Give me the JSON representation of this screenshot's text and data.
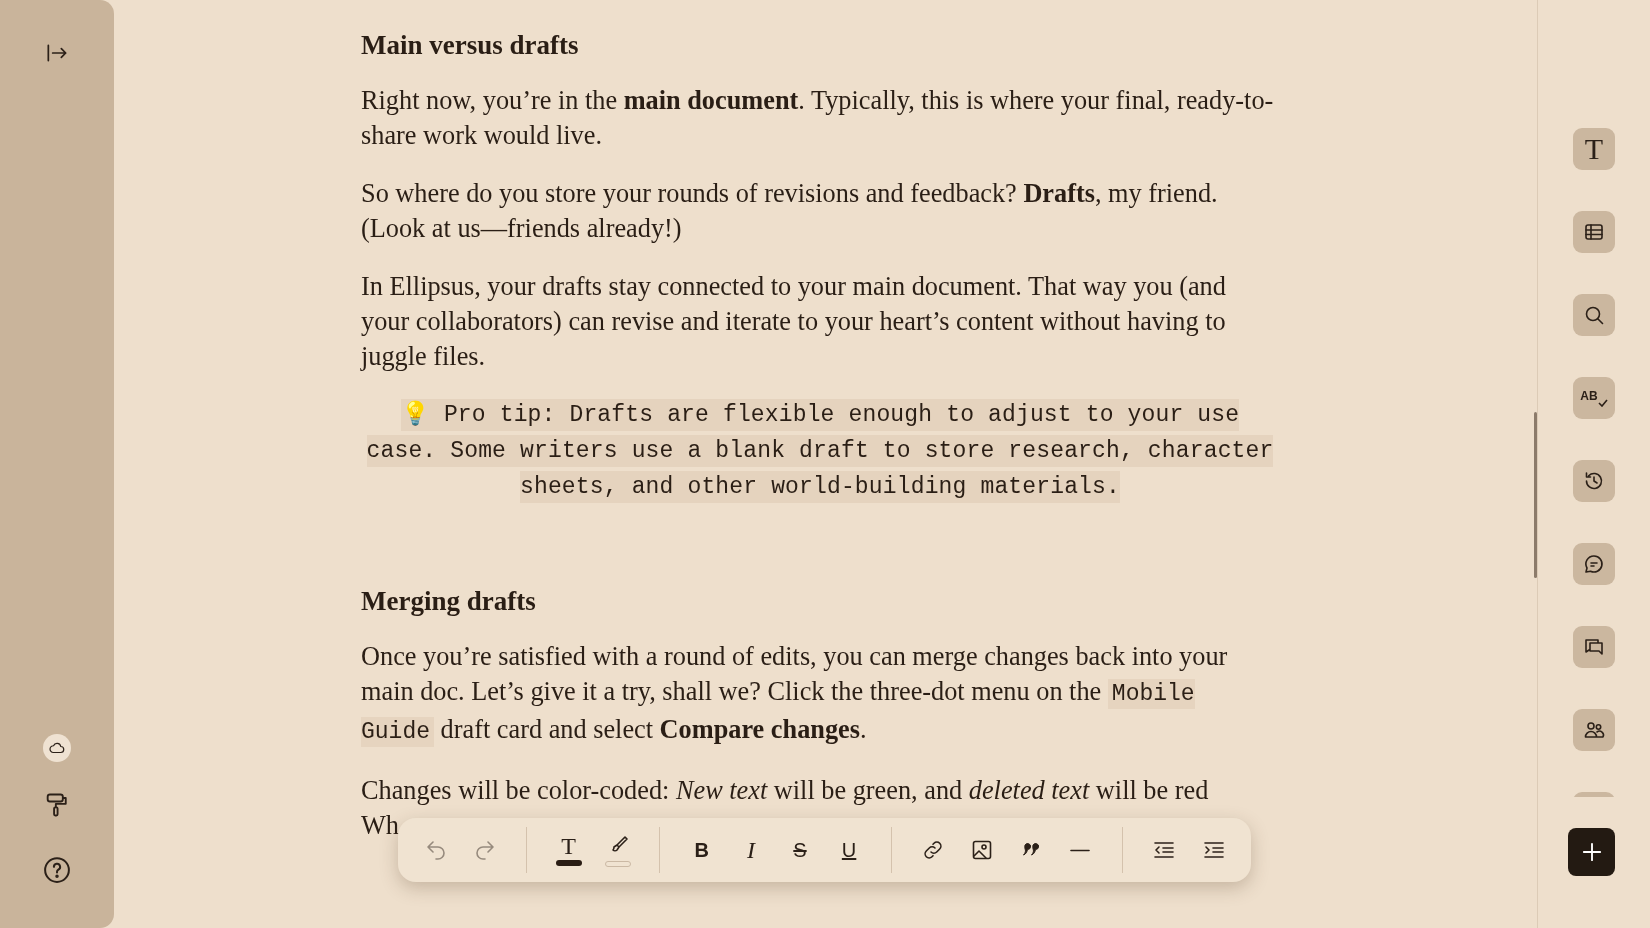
{
  "document": {
    "sections": [
      {
        "heading": "Main versus drafts",
        "blocks": [
          {
            "kind": "paragraph",
            "segments": [
              {
                "kind": "rich",
                "text": "Right now, you’re in the **main document**. Typically, this is where your final, ready-to-share work would live."
              }
            ]
          },
          {
            "kind": "paragraph",
            "segments": [
              {
                "kind": "rich",
                "text": "So where do you store your rounds of revisions and feedback? **Drafts**, my friend. (Look at us—friends already!)"
              }
            ]
          },
          {
            "kind": "paragraph",
            "segments": [
              {
                "kind": "rich",
                "text": "In Ellipsus, your drafts stay connected to your main document. That way you (and your collaborators) can revise and iterate to your heart’s content without having to juggle files."
              }
            ]
          },
          {
            "kind": "callout",
            "emoji": "💡",
            "text": "Pro tip: Drafts are flexible enough to adjust to your use case. Some writers use a blank draft to store research, character sheets, and other world-building materials."
          }
        ]
      },
      {
        "heading": "Merging drafts",
        "blocks": [
          {
            "kind": "paragraph",
            "segments": [
              {
                "kind": "rich",
                "text": "Once you’re satisfied with a round of edits, you can merge changes back into your main doc. Let’s give it a try, shall we? Click the three-dot menu on the "
              },
              {
                "kind": "code",
                "text": "Mobile Guide"
              },
              {
                "kind": "rich",
                "text": " draft card and select **Compare changes**."
              }
            ]
          },
          {
            "kind": "cut_paragraph",
            "lines": [
              "Changes will be color-coded: *New text* will be green, and *deleted text* will be red",
              "Wh"
            ]
          }
        ]
      }
    ]
  },
  "toolbar": {
    "groups": [
      {
        "items": [
          {
            "kind": "undo",
            "disabled": true
          },
          {
            "kind": "redo",
            "disabled": true
          }
        ]
      },
      {
        "items": [
          {
            "kind": "text_color",
            "label": "T",
            "disabled": false
          },
          {
            "kind": "highlight",
            "disabled": false
          }
        ]
      },
      {
        "items": [
          {
            "kind": "bold",
            "label": "B",
            "disabled": false
          },
          {
            "kind": "italic",
            "label": "I",
            "disabled": false
          },
          {
            "kind": "strike",
            "label": "S",
            "disabled": false
          },
          {
            "kind": "underline",
            "label": "U",
            "disabled": false
          }
        ]
      },
      {
        "items": [
          {
            "kind": "link",
            "disabled": false
          },
          {
            "kind": "image",
            "disabled": false
          },
          {
            "kind": "quote",
            "disabled": false
          },
          {
            "kind": "rule",
            "disabled": false
          }
        ]
      },
      {
        "items": [
          {
            "kind": "outdent",
            "disabled": false
          },
          {
            "kind": "indent",
            "disabled": false
          }
        ]
      }
    ]
  },
  "right_rail": {
    "items": [
      {
        "kind": "text",
        "label": "T"
      },
      {
        "kind": "table"
      },
      {
        "kind": "search"
      },
      {
        "kind": "spellcheck",
        "label": "AB"
      },
      {
        "kind": "history"
      },
      {
        "kind": "comment"
      },
      {
        "kind": "comments"
      },
      {
        "kind": "people"
      },
      {
        "kind": "cut"
      }
    ]
  }
}
